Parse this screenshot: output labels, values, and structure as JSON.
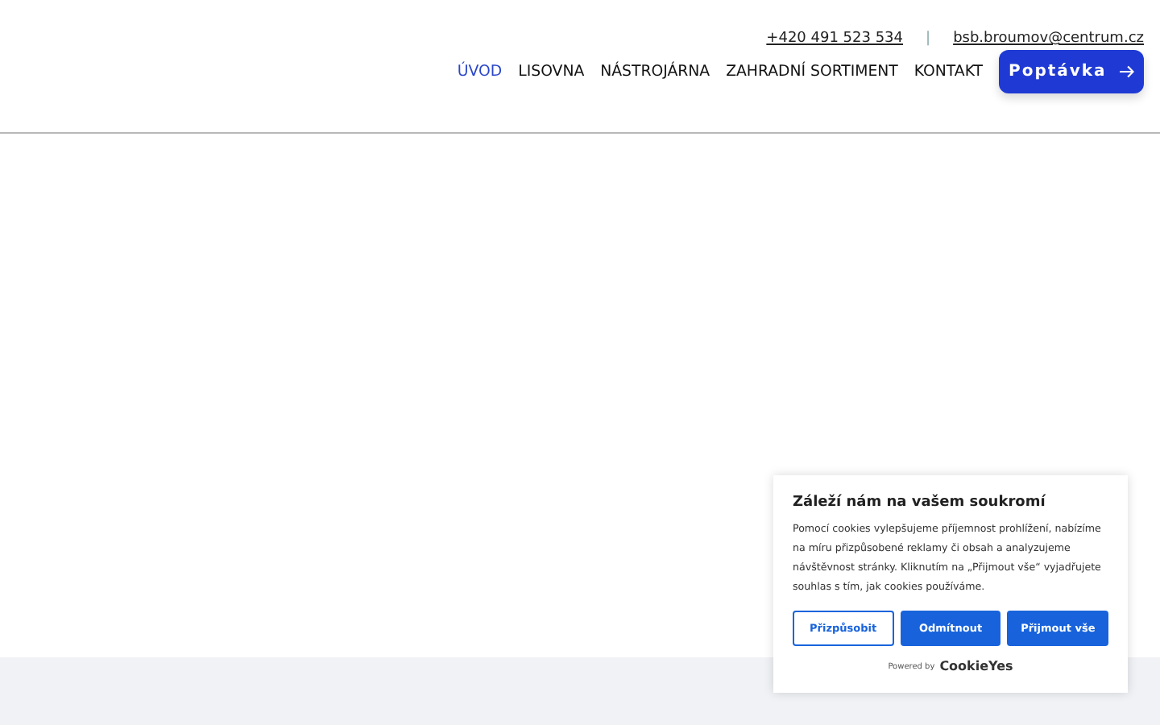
{
  "contacts": {
    "phone": "+420 491 523 534",
    "separator": "|",
    "email": "bsb.broumov@centrum.cz"
  },
  "nav": [
    {
      "label": "ÚVOD",
      "selected": true
    },
    {
      "label": "LISOVNA",
      "selected": false
    },
    {
      "label": "NÁSTROJÁRNA",
      "selected": false
    },
    {
      "label": "ZAHRADNÍ SORTIMENT",
      "selected": false
    },
    {
      "label": "KONTAKT",
      "selected": false
    }
  ],
  "cta": {
    "label": "Poptávka"
  },
  "cookie_banner": {
    "title": "Záleží nám na vašem soukromí",
    "text": "Pomocí cookies vylepšujeme příjemnost prohlížení, nabízíme na míru přizpůsobené reklamy či obsah a analyzujeme návštěvnost stránky. Kliknutím na „Přijmout vše“ vyjadřujete souhlas s tím, jak cookies používáme.",
    "buttons": [
      {
        "label": "Přizpůsobit",
        "kind": "outline"
      },
      {
        "label": "Odmítnout",
        "kind": "filled"
      },
      {
        "label": "Přijmout vše",
        "kind": "filled"
      }
    ],
    "powered_by": "Powered by",
    "brand": "CookieYes"
  }
}
